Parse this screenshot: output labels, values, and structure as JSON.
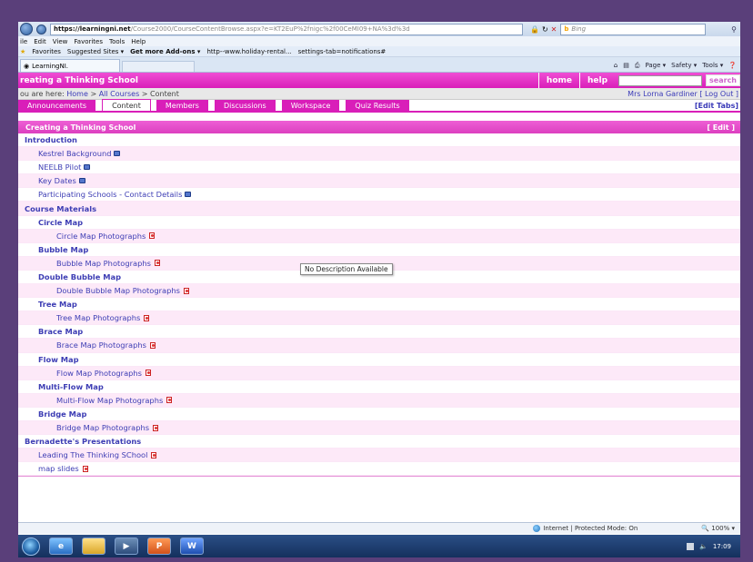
{
  "browser": {
    "address_host": "https://learningni.net",
    "address_path": "/Course2000/CourseContentBrowse.aspx?e=KT2EuP%2fnigc%2f00CeMI09+NA%3d%3d",
    "search_engine": "Bing",
    "menu": [
      "ile",
      "Edit",
      "View",
      "Favorites",
      "Tools",
      "Help"
    ],
    "favorites_label": "Favorites",
    "favorites_items": [
      "Suggested Sites ▾",
      "Get more Add-ons ▾",
      "http--www.holiday-rental...",
      "settings-tab=notifications#"
    ],
    "tab_title": "LearningNI.",
    "command_bar": [
      "Page ▾",
      "Safety ▾",
      "Tools ▾"
    ],
    "status_zone": "Internet | Protected Mode: On",
    "zoom": "100%",
    "clock": "17:09"
  },
  "site": {
    "title": "reating a Thinking School",
    "links": [
      "home",
      "help"
    ],
    "search_button": "search",
    "crumb_prefix": "ou are here:",
    "crumbs": [
      "Home",
      "All Courses",
      "Content"
    ],
    "crumb_sep": ">",
    "user_name": "Mrs Lorna Gardiner",
    "logout_label": "[ Log Out ]",
    "edit_tabs_label": "[Edit Tabs]"
  },
  "tabs": [
    {
      "label": "Announcements",
      "active": false
    },
    {
      "label": "Content",
      "active": true
    },
    {
      "label": "Members",
      "active": false
    },
    {
      "label": "Discussions",
      "active": false
    },
    {
      "label": "Workspace",
      "active": false
    },
    {
      "label": "Quiz Results",
      "active": false
    }
  ],
  "content": {
    "header": "Creating a Thinking School",
    "edit_label": "[ Edit ]",
    "tooltip": "No Description Available",
    "rows": [
      {
        "label": "Introduction",
        "level": 0,
        "kind": "section",
        "icon": ""
      },
      {
        "label": "Kestrel Background",
        "level": 1,
        "kind": "item",
        "icon": "doc"
      },
      {
        "label": "NEELB Pilot",
        "level": 1,
        "kind": "item",
        "icon": "doc"
      },
      {
        "label": "Key Dates",
        "level": 1,
        "kind": "item",
        "icon": "doc"
      },
      {
        "label": "Participating Schools - Contact Details",
        "level": 1,
        "kind": "item",
        "icon": "doc"
      },
      {
        "label": "Course Materials",
        "level": 0,
        "kind": "section",
        "icon": ""
      },
      {
        "label": "Circle Map",
        "level": 1,
        "kind": "folder",
        "icon": ""
      },
      {
        "label": "Circle Map Photographs",
        "level": 2,
        "kind": "item",
        "icon": "pdf"
      },
      {
        "label": "Bubble Map",
        "level": 1,
        "kind": "folder",
        "icon": ""
      },
      {
        "label": "Bubble Map Photographs",
        "level": 2,
        "kind": "item",
        "icon": "pdf"
      },
      {
        "label": "Double Bubble Map",
        "level": 1,
        "kind": "folder",
        "icon": ""
      },
      {
        "label": "Double Bubble Map Photographs",
        "level": 2,
        "kind": "item",
        "icon": "pdf"
      },
      {
        "label": "Tree Map",
        "level": 1,
        "kind": "folder",
        "icon": ""
      },
      {
        "label": "Tree Map Photographs",
        "level": 2,
        "kind": "item",
        "icon": "pdf"
      },
      {
        "label": "Brace Map",
        "level": 1,
        "kind": "folder",
        "icon": ""
      },
      {
        "label": "Brace Map Photographs",
        "level": 2,
        "kind": "item",
        "icon": "pdf"
      },
      {
        "label": "Flow Map",
        "level": 1,
        "kind": "folder",
        "icon": ""
      },
      {
        "label": "Flow Map Photographs",
        "level": 2,
        "kind": "item",
        "icon": "pdf"
      },
      {
        "label": "Multi-Flow Map",
        "level": 1,
        "kind": "folder",
        "icon": ""
      },
      {
        "label": "Multi-Flow Map Photographs",
        "level": 2,
        "kind": "item",
        "icon": "pdf"
      },
      {
        "label": "Bridge Map",
        "level": 1,
        "kind": "folder",
        "icon": ""
      },
      {
        "label": "Bridge Map Photographs",
        "level": 2,
        "kind": "item",
        "icon": "pdf"
      },
      {
        "label": "Bernadette's Presentations",
        "level": 0,
        "kind": "section",
        "icon": ""
      },
      {
        "label": "Leading The Thinking SChool",
        "level": 1,
        "kind": "item",
        "icon": "pdf"
      },
      {
        "label": "map slides",
        "level": 1,
        "kind": "item",
        "icon": "pdf"
      }
    ]
  }
}
